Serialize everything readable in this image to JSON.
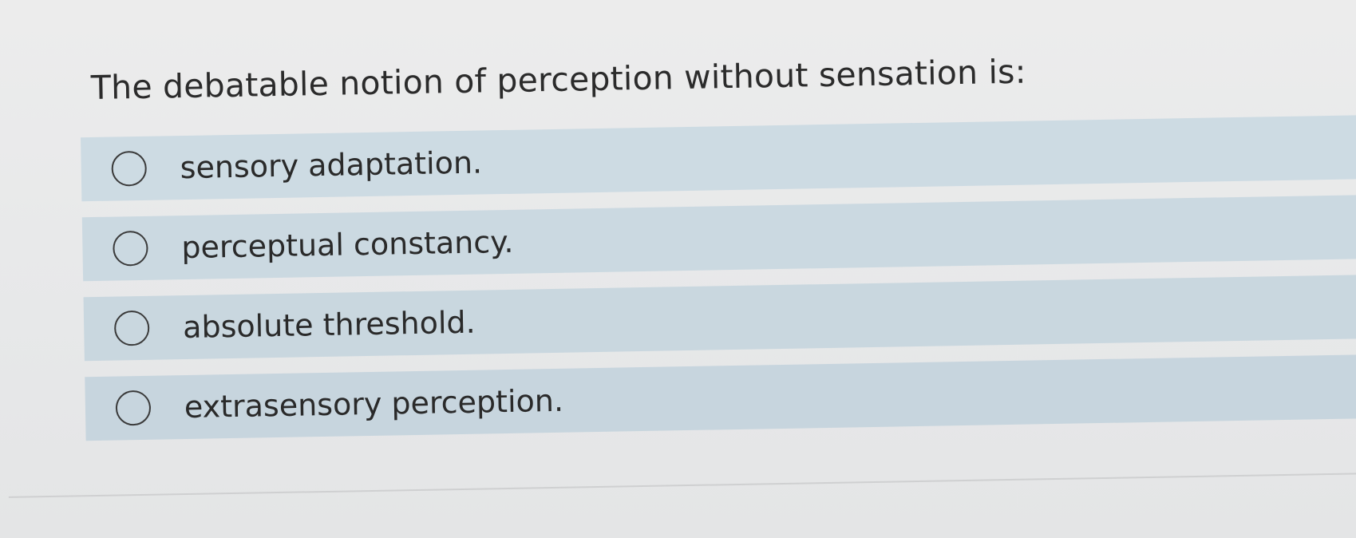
{
  "question": {
    "text": "The debatable notion of perception without sensation is:"
  },
  "options": [
    {
      "label": "sensory adaptation.",
      "icon": "radio-unchecked-icon",
      "selected": false
    },
    {
      "label": "perceptual constancy.",
      "icon": "radio-unchecked-icon",
      "selected": false
    },
    {
      "label": "absolute threshold.",
      "icon": "radio-unchecked-icon",
      "selected": false
    },
    {
      "label": "extrasensory perception.",
      "icon": "radio-unchecked-icon",
      "selected": false
    }
  ],
  "colors": {
    "option_background": "#cddbe3",
    "page_background": "#e8e9ea",
    "text": "#2b2b2b"
  }
}
